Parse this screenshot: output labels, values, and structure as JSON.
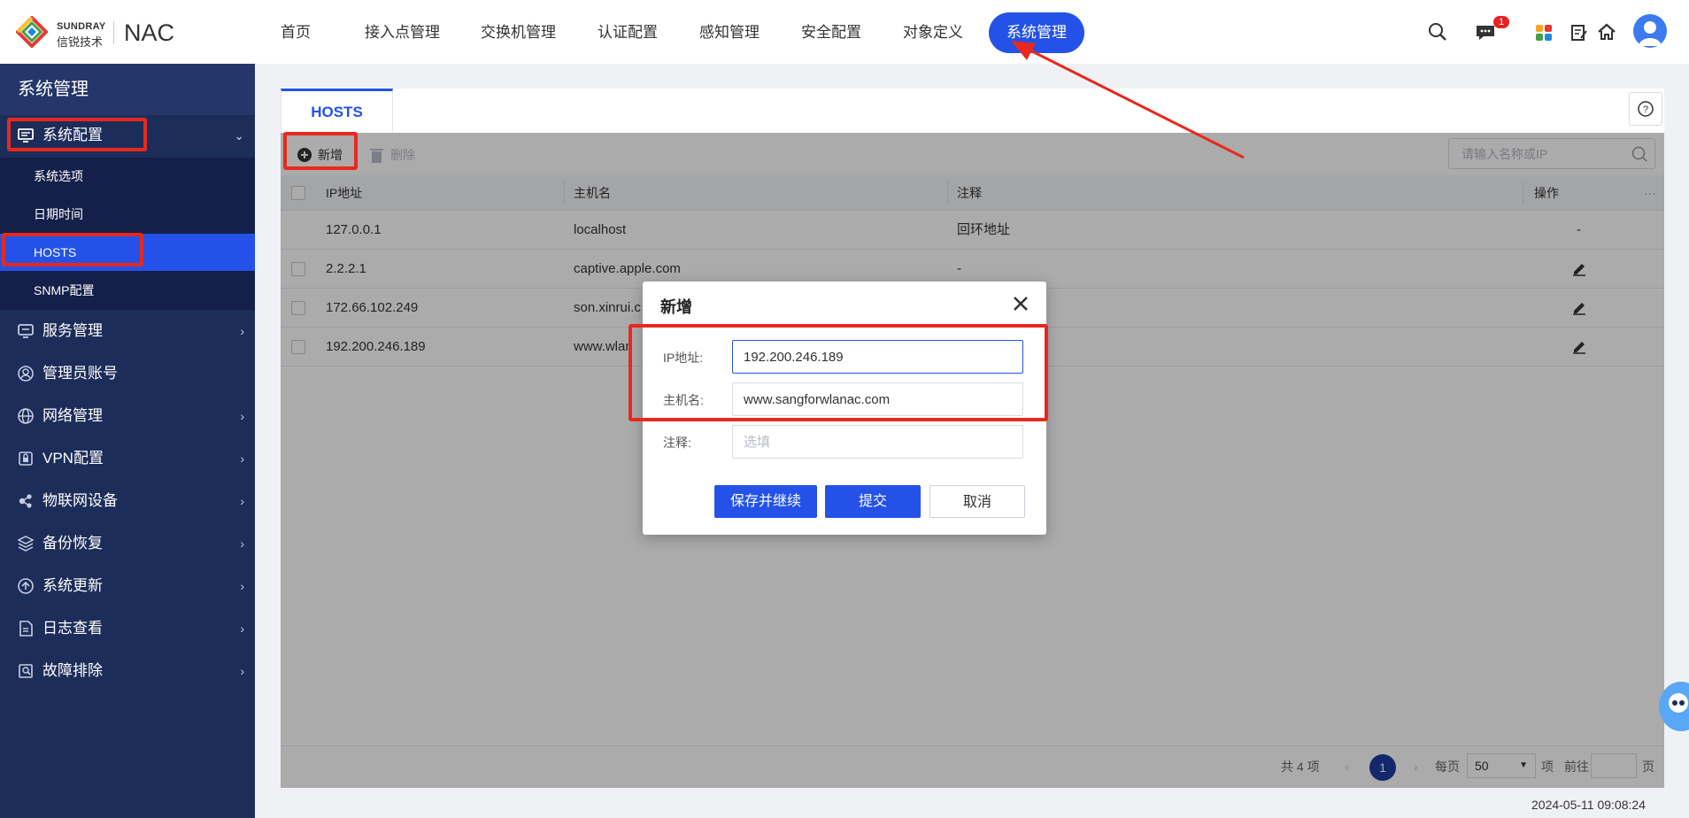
{
  "header": {
    "brand_en": "SUNDRAY",
    "brand_cn": "信锐技术",
    "product": "NAC",
    "nav": [
      "首页",
      "接入点管理",
      "交换机管理",
      "认证配置",
      "感知管理",
      "安全配置",
      "对象定义",
      "系统管理"
    ],
    "active_nav": "系统管理",
    "notification_count": "1",
    "icons": [
      "search-icon",
      "message-icon",
      "apps-icon",
      "notes-icon",
      "home-icon",
      "avatar"
    ]
  },
  "sidebar": {
    "title": "系统管理",
    "items": [
      {
        "label": "系统配置",
        "icon": "monitor-icon",
        "expanded": true
      },
      {
        "label": "服务管理",
        "icon": "server-icon"
      },
      {
        "label": "管理员账号",
        "icon": "user-circle-icon"
      },
      {
        "label": "网络管理",
        "icon": "globe-icon"
      },
      {
        "label": "VPN配置",
        "icon": "lock-icon"
      },
      {
        "label": "物联网设备",
        "icon": "iot-icon"
      },
      {
        "label": "备份恢复",
        "icon": "layers-icon"
      },
      {
        "label": "系统更新",
        "icon": "upload-icon"
      },
      {
        "label": "日志查看",
        "icon": "log-icon"
      },
      {
        "label": "故障排除",
        "icon": "troubleshoot-icon"
      }
    ],
    "sub_items": [
      "系统选项",
      "日期时间",
      "HOSTS",
      "SNMP配置"
    ],
    "active_sub": "HOSTS"
  },
  "page": {
    "tab": "HOSTS",
    "toolbar": {
      "add": "新增",
      "delete": "删除"
    },
    "search": {
      "placeholder": "请输入名称或IP"
    },
    "table": {
      "columns": [
        "IP地址",
        "主机名",
        "注释",
        "操作"
      ],
      "rows": [
        {
          "ip": "127.0.0.1",
          "host": "localhost",
          "note": "回环地址",
          "op": "-"
        },
        {
          "ip": "2.2.2.1",
          "host": "captive.apple.com",
          "note": "-",
          "op": "edit"
        },
        {
          "ip": "172.66.102.249",
          "host": "son.xinrui.c",
          "note": "",
          "op": "edit"
        },
        {
          "ip": "192.200.246.189",
          "host": "www.wlan",
          "note": "",
          "op": "edit"
        }
      ]
    },
    "pagination": {
      "total": "共 4 项",
      "current_page": "1",
      "per_page_label": "每页",
      "per_page": "50",
      "items_unit": "项",
      "goto_label": "前往",
      "page_unit": "页"
    },
    "datetime": "2024-05-11 09:08:24"
  },
  "modal": {
    "title": "新增",
    "fields": {
      "ip_label": "IP地址:",
      "ip_value": "192.200.246.189",
      "host_label": "主机名:",
      "host_value": "www.sangforwlanac.com",
      "note_label": "注释:",
      "note_placeholder": "选填"
    },
    "buttons": {
      "save_continue": "保存并继续",
      "submit": "提交",
      "cancel": "取消"
    }
  },
  "colors": {
    "accent": "#2452e8",
    "sidebar": "#1d2d5a",
    "highlight": "#e8281e"
  }
}
